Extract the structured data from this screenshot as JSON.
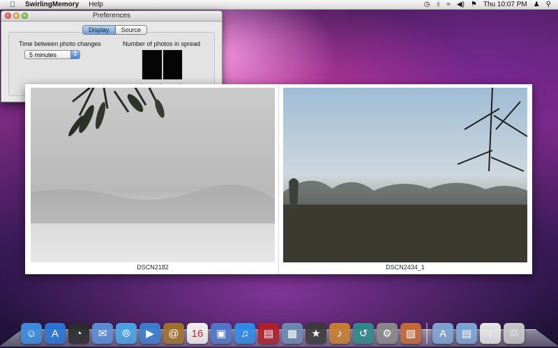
{
  "menubar": {
    "apple_icon": "apple-icon",
    "app_name": "SwirlingMemory",
    "menus": [
      "Help"
    ],
    "clock": "Thu 10:07 PM"
  },
  "preferences_window": {
    "title": "Preferences",
    "tabs": [
      {
        "label": "Display",
        "selected": true
      },
      {
        "label": "Source",
        "selected": false
      }
    ],
    "time_label": "Time between photo changes",
    "time_value": "5 minutes",
    "spread_label": "Number of photos in spread",
    "spread_count": 2
  },
  "spread": {
    "captions": [
      "DSCN2182",
      "DSCN2434_1"
    ]
  },
  "dock": {
    "apps": [
      {
        "name": "finder-icon",
        "color": "#3d8ee0"
      },
      {
        "name": "app-store-icon",
        "color": "#2a75d8"
      },
      {
        "name": "dashboard-icon",
        "color": "#2b2b2b"
      },
      {
        "name": "mail-icon",
        "color": "#5a8fd6"
      },
      {
        "name": "safari-icon",
        "color": "#4aa5e8"
      },
      {
        "name": "facetime-icon",
        "color": "#3b7fd0"
      },
      {
        "name": "address-book-icon",
        "color": "#a1742b"
      },
      {
        "name": "ical-icon",
        "color": "#f2f2f2"
      },
      {
        "name": "preview-icon",
        "color": "#4f79c9"
      },
      {
        "name": "itunes-icon",
        "color": "#2d8de8"
      },
      {
        "name": "photo-booth-icon",
        "color": "#b0212a"
      },
      {
        "name": "iphoto-icon",
        "color": "#6c8ab0"
      },
      {
        "name": "imovie-icon",
        "color": "#3a3a3a"
      },
      {
        "name": "garageband-icon",
        "color": "#c7812f"
      },
      {
        "name": "time-machine-icon",
        "color": "#2f8a8a"
      },
      {
        "name": "system-preferences-icon",
        "color": "#8a8a8a"
      },
      {
        "name": "swirlingmemory-icon",
        "color": "#c46d39"
      }
    ],
    "stacks": [
      {
        "name": "applications-folder-icon",
        "color": "#7fa7d6"
      },
      {
        "name": "documents-folder-icon",
        "color": "#7fa7d6"
      },
      {
        "name": "downloads-stack-icon",
        "color": "#e8e8e8"
      },
      {
        "name": "trash-icon",
        "color": "#c9c9c9"
      }
    ]
  }
}
